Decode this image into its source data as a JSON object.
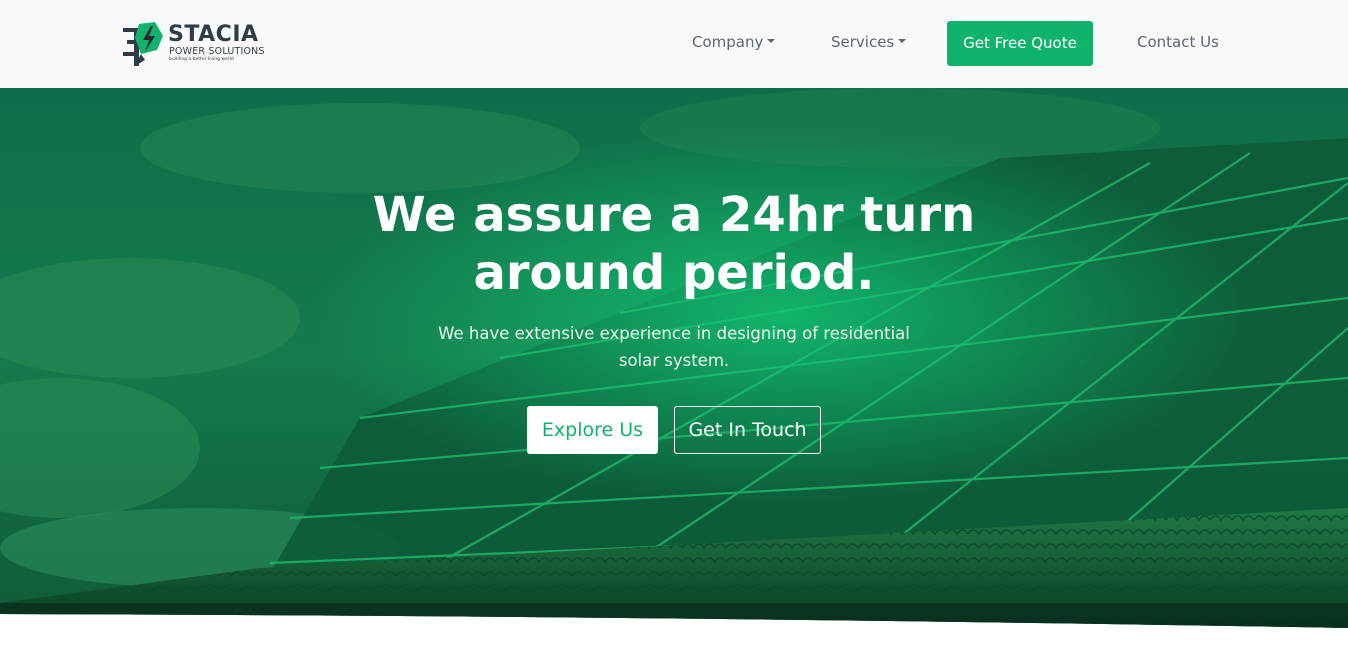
{
  "brand": {
    "name": "STACIA",
    "subtitle": "POWER SOLUTIONS",
    "tagline": "building a better living world",
    "accent_color": "#10b36c",
    "logo_icon": "lightning-bolt-icon"
  },
  "nav": {
    "company_label": "Company",
    "services_label": "Services",
    "quote_label": "Get Free Quote",
    "contact_label": "Contact Us"
  },
  "hero": {
    "title": "We assure a 24hr turn around period.",
    "subtitle": "We have extensive experience in designing of residential solar system.",
    "explore_label": "Explore Us",
    "touch_label": "Get In Touch",
    "background": "solar-panels-on-roof-image"
  }
}
